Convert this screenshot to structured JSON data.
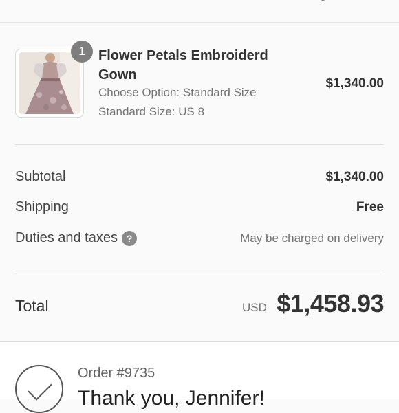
{
  "product": {
    "quantity": "1",
    "name": "Flower Petals Embroiderd Gown",
    "option_line": "Choose Option: Standard Size",
    "size_line": "Standard Size: US 8",
    "price": "$1,340.00"
  },
  "totals": {
    "subtotal_label": "Subtotal",
    "subtotal_value": "$1,340.00",
    "shipping_label": "Shipping",
    "shipping_value": "Free",
    "duties_label": "Duties and taxes",
    "duties_value": "May be charged on delivery",
    "help_icon": "question-circle-icon",
    "total_label": "Total",
    "currency": "USD",
    "total_value": "$1,458.93"
  },
  "order": {
    "number": "Order #9735",
    "thank_you": "Thank you, Jennifer!",
    "status_icon": "checkmark-circle-icon"
  },
  "colors": {
    "background": "#fafafa",
    "badge": "#7f7f7f",
    "muted_text": "#737373",
    "primary_text": "#333333"
  }
}
